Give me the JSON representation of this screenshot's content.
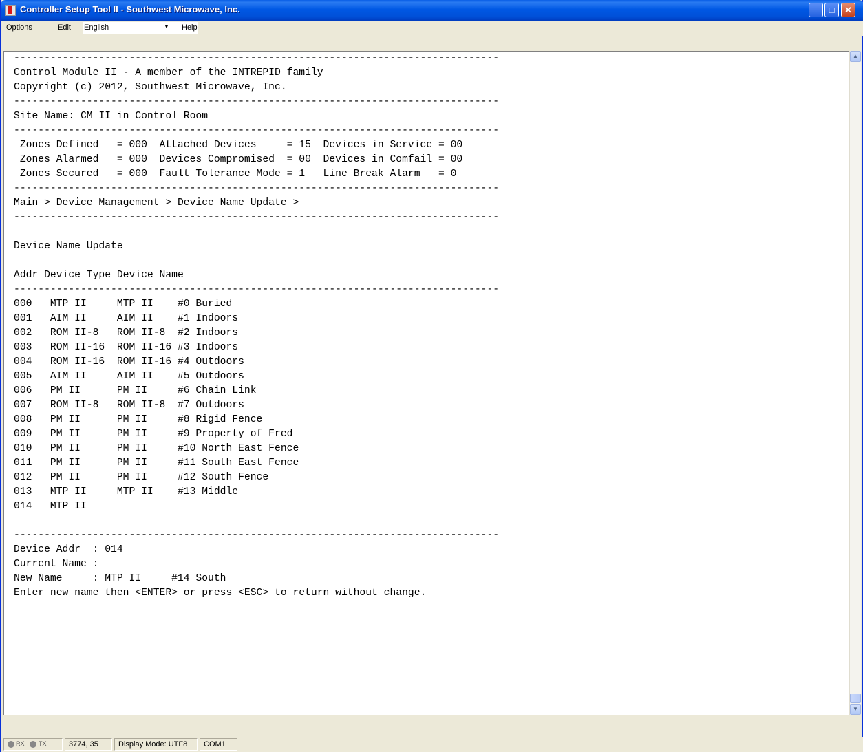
{
  "window": {
    "title": "Controller Setup Tool II - Southwest Microwave, Inc.",
    "controls": {
      "minimize": "_",
      "maximize": "□",
      "close": "✕"
    }
  },
  "menu": {
    "options": "Options",
    "edit": "Edit",
    "language": {
      "selected": "English",
      "arrow": "▼"
    },
    "help": "Help"
  },
  "terminal": {
    "lines": [
      "--------------------------------------------------------------------------------",
      "Control Module II - A member of the INTREPID family",
      "Copyright (c) 2012, Southwest Microwave, Inc.",
      "--------------------------------------------------------------------------------",
      "Site Name: CM II in Control Room",
      "--------------------------------------------------------------------------------",
      " Zones Defined   = 000  Attached Devices     = 15  Devices in Service = 00",
      " Zones Alarmed   = 000  Devices Compromised  = 00  Devices in Comfail = 00",
      " Zones Secured   = 000  Fault Tolerance Mode = 1   Line Break Alarm   = 0",
      "--------------------------------------------------------------------------------",
      "Main > Device Management > Device Name Update >",
      "--------------------------------------------------------------------------------",
      "",
      "Device Name Update",
      "",
      "Addr Device Type Device Name",
      "--------------------------------------------------------------------------------",
      "000   MTP II     MTP II    #0 Buried",
      "001   AIM II     AIM II    #1 Indoors",
      "002   ROM II-8   ROM II-8  #2 Indoors",
      "003   ROM II-16  ROM II-16 #3 Indoors",
      "004   ROM II-16  ROM II-16 #4 Outdoors",
      "005   AIM II     AIM II    #5 Outdoors",
      "006   PM II      PM II     #6 Chain Link",
      "007   ROM II-8   ROM II-8  #7 Outdoors",
      "008   PM II      PM II     #8 Rigid Fence",
      "009   PM II      PM II     #9 Property of Fred",
      "010   PM II      PM II     #10 North East Fence",
      "011   PM II      PM II     #11 South East Fence",
      "012   PM II      PM II     #12 South Fence",
      "013   MTP II     MTP II    #13 Middle",
      "014   MTP II",
      "",
      "--------------------------------------------------------------------------------",
      "Device Addr  : 014",
      "Current Name :",
      "New Name     : MTP II     #14 South",
      "Enter new name then <ENTER> or press <ESC> to return without change."
    ]
  },
  "status": {
    "rx": "RX",
    "tx": "TX",
    "coords": "3774, 35",
    "display_mode": "Display Mode: UTF8",
    "port": "COM1"
  },
  "icons": {
    "app": "app-icon",
    "scroll_up": "▲",
    "scroll_down": "▼"
  }
}
